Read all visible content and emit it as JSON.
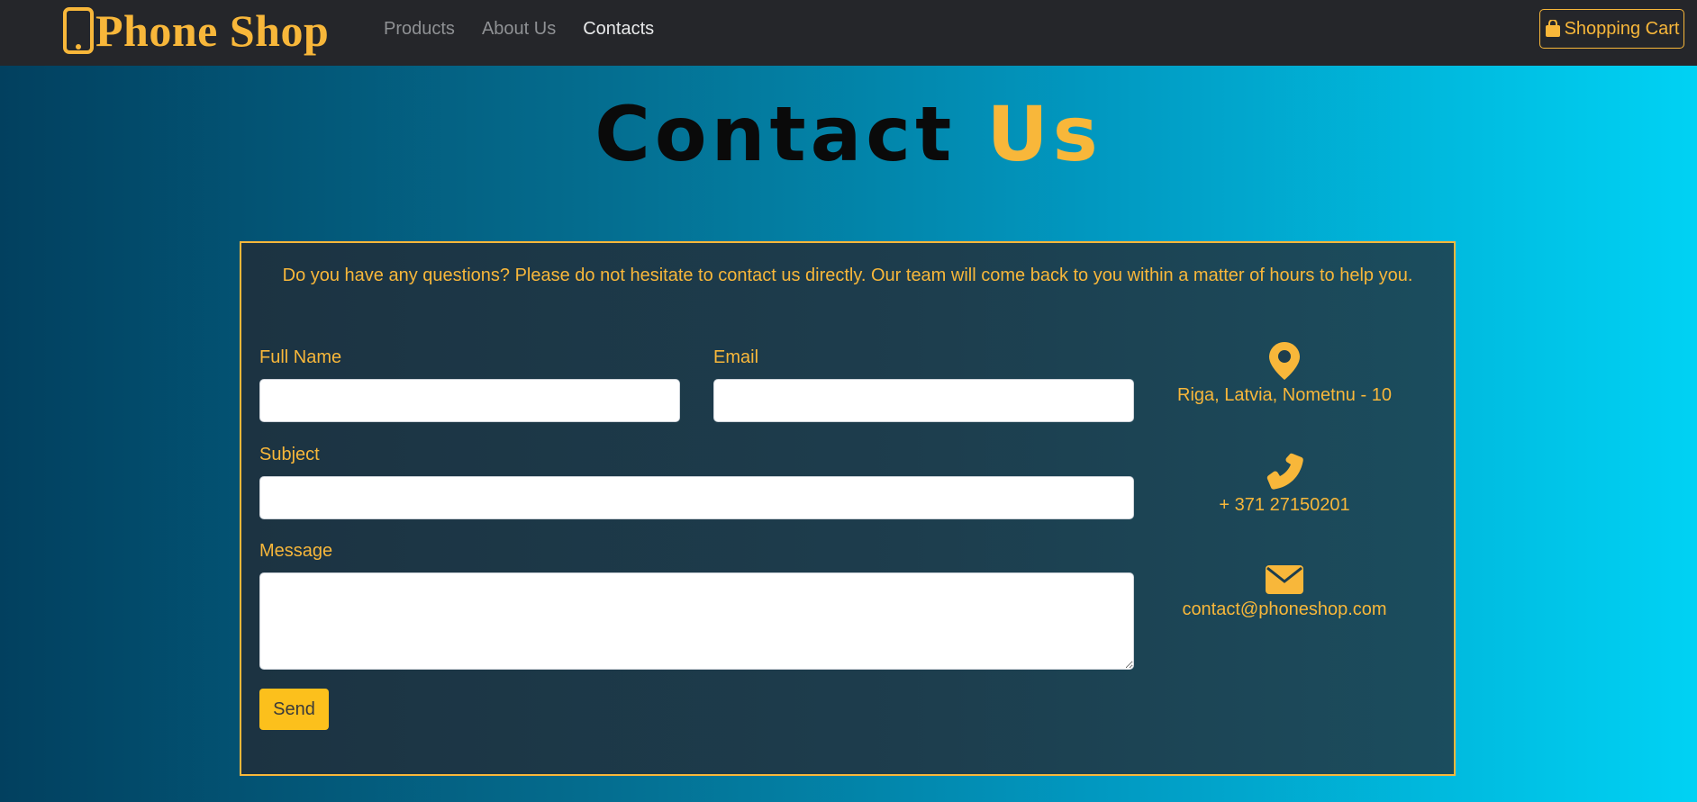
{
  "navbar": {
    "brand": "Phone Shop",
    "links": [
      "Products",
      "About Us",
      "Contacts"
    ],
    "cart_label": "Shopping Cart"
  },
  "title": {
    "part1": "Contact",
    "part2": "Us"
  },
  "panel": {
    "intro": "Do you have any questions? Please do not hesitate to contact us directly. Our team will come back to you within a matter of hours to help you.",
    "form": {
      "full_name_label": "Full Name",
      "email_label": "Email",
      "subject_label": "Subject",
      "message_label": "Message",
      "full_name_value": "",
      "email_value": "",
      "subject_value": "",
      "message_value": "",
      "send_label": "Send"
    },
    "contact": {
      "address": "Riga, Latvia, Nometnu - 10",
      "phone": "+ 371 27150201",
      "email": "contact@phoneshop.com"
    }
  },
  "colors": {
    "accent": "#f8b73a",
    "send_button": "#fcc01c",
    "navbar_bg": "#25262a",
    "panel_bg": "#1d3d4d"
  },
  "icons": {
    "brand": "mobile-phone-icon",
    "cart": "shopping-bag-icon",
    "address": "map-marker-icon",
    "phone": "phone-icon",
    "email": "envelope-icon"
  }
}
